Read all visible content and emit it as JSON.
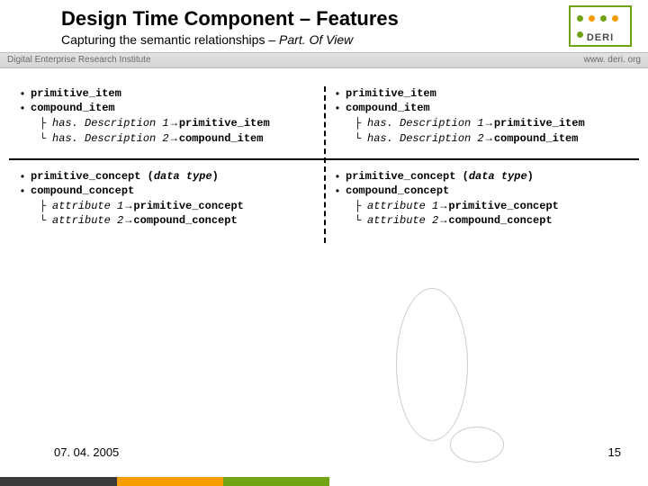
{
  "header": {
    "title": "Design Time Component – Features",
    "subtitle_plain": "Capturing the semantic relationships – ",
    "subtitle_italic": "Part. Of View",
    "subbar_left": "Digital Enterprise Research Institute",
    "subbar_right": "www. deri. org",
    "logo_text": "DERI"
  },
  "blocks": {
    "topLeft": {
      "b1": "primitive_item",
      "b2": "compound_item",
      "t1_lhs": "has. Description 1",
      "t1_rhs": "primitive_item",
      "t2_lhs": "has. Description 2",
      "t2_rhs": "compound_item"
    },
    "topRight": {
      "b1": "primitive_item",
      "b2": "compound_item",
      "t1_lhs": "has. Description 1",
      "t1_rhs": "primitive_item",
      "t2_lhs": "has. Description 2",
      "t2_rhs": "compound_item"
    },
    "botLeft": {
      "b1_pre": "primitive_concept (",
      "b1_ital": "data type",
      "b1_post": ")",
      "b2": "compound_concept",
      "t1_lhs": "attribute 1",
      "t1_rhs": "primitive_concept",
      "t2_lhs": "attribute 2",
      "t2_rhs": "compound_concept"
    },
    "botRight": {
      "b1_pre": "primitive_concept (",
      "b1_ital": "data type",
      "b1_post": ")",
      "b2": "compound_concept",
      "t1_lhs": "attribute 1",
      "t1_rhs": "primitive_concept",
      "t2_lhs": "attribute 2",
      "t2_rhs": "compound_concept"
    }
  },
  "arrow": "→",
  "footer": {
    "date": "07. 04. 2005",
    "page": "15"
  }
}
